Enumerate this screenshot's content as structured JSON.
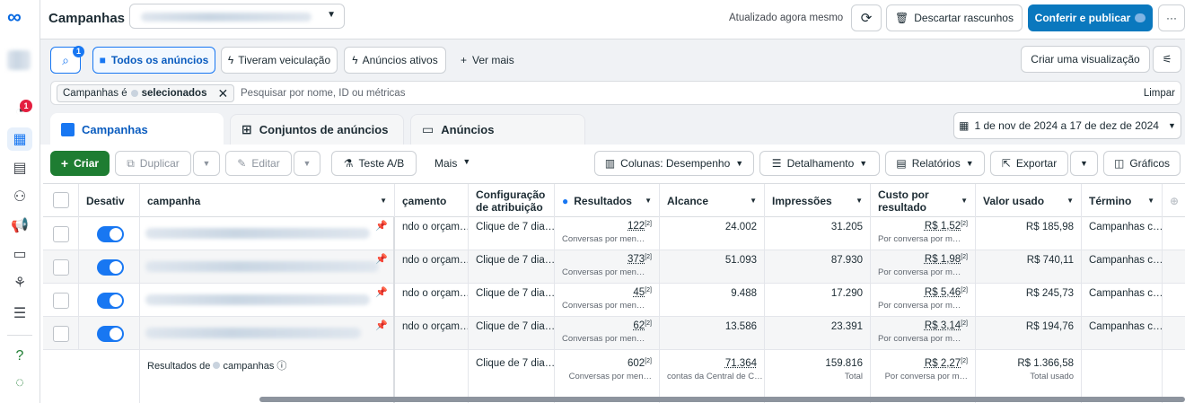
{
  "topbar": {
    "title": "Campanhas",
    "updated": "Atualizado agora mesmo",
    "discard": "Descartar rascunhos",
    "publish": "Conferir e publicar",
    "more": "···"
  },
  "filters": {
    "search_badge": "1",
    "all_ads": "Todos os anúncios",
    "had_delivery": "Tiveram veiculação",
    "active_ads": "Anúncios ativos",
    "see_more": "Ver mais",
    "create_view": "Criar uma visualização"
  },
  "searchbar": {
    "chip_prefix": "Campanhas é",
    "chip_suffix": "selecionados",
    "placeholder": "Pesquisar por nome, ID ou métricas",
    "clear": "Limpar"
  },
  "tabs": {
    "campaigns": "Campanhas",
    "adsets": "Conjuntos de anúncios",
    "ads": "Anúncios",
    "daterange": "1 de nov de 2024 a 17 de dez de 2024"
  },
  "toolbar": {
    "create": "Criar",
    "duplicate": "Duplicar",
    "edit": "Editar",
    "abtest": "Teste A/B",
    "more": "Mais",
    "columns": "Colunas: Desempenho",
    "breakdown": "Detalhamento",
    "reports": "Relatórios",
    "export": "Exportar",
    "charts": "Gráficos"
  },
  "nav": {
    "badge": "1"
  },
  "table": {
    "headers": {
      "off": "Desativ",
      "campaign": "campanha",
      "budget": "çamento",
      "attribution": "Configuração de atribuição",
      "results": "Resultados",
      "reach": "Alcance",
      "impressions": "Impressões",
      "cost": "Custo por resultado",
      "spent": "Valor usado",
      "end": "Término"
    },
    "rows": [
      {
        "budget": "ndo o orçam…",
        "attribution": "Clique de 7 dia…",
        "results": "122",
        "results_sub": "Conversas por men…",
        "reach": "24.002",
        "impressions": "31.205",
        "cost": "R$ 1,52",
        "cost_sub": "Por conversa por m…",
        "spent": "R$ 185,98",
        "end": "Campanhas c…"
      },
      {
        "budget": "ndo o orçam…",
        "attribution": "Clique de 7 dia…",
        "results": "373",
        "results_sub": "Conversas por men…",
        "reach": "51.093",
        "impressions": "87.930",
        "cost": "R$ 1,98",
        "cost_sub": "Por conversa por m…",
        "spent": "R$ 740,11",
        "end": "Campanhas c…"
      },
      {
        "budget": "ndo o orçam…",
        "attribution": "Clique de 7 dia…",
        "results": "45",
        "results_sub": "Conversas por men…",
        "reach": "9.488",
        "impressions": "17.290",
        "cost": "R$ 5,46",
        "cost_sub": "Por conversa por m…",
        "spent": "R$ 245,73",
        "end": "Campanhas c…"
      },
      {
        "budget": "ndo o orçam…",
        "attribution": "Clique de 7 dia…",
        "results": "62",
        "results_sub": "Conversas por men…",
        "reach": "13.586",
        "impressions": "23.391",
        "cost": "R$ 3,14",
        "cost_sub": "Por conversa por m…",
        "spent": "R$ 194,76",
        "end": "Campanhas c…"
      }
    ],
    "summary": {
      "label_prefix": "Resultados de",
      "label_suffix": "campanhas",
      "attribution": "Clique de 7 dia…",
      "results": "602",
      "results_sub": "Conversas por men…",
      "reach": "71.364",
      "reach_sub": "contas da Central de C…",
      "impressions": "159.816",
      "impressions_sub": "Total",
      "cost": "R$ 2,27",
      "cost_sub": "Por conversa por m…",
      "spent": "R$ 1.366,58",
      "spent_sub": "Total usado"
    }
  },
  "colors": {
    "accent": "#1877f2",
    "primary": "#0a78be",
    "create": "#1e7d32"
  }
}
